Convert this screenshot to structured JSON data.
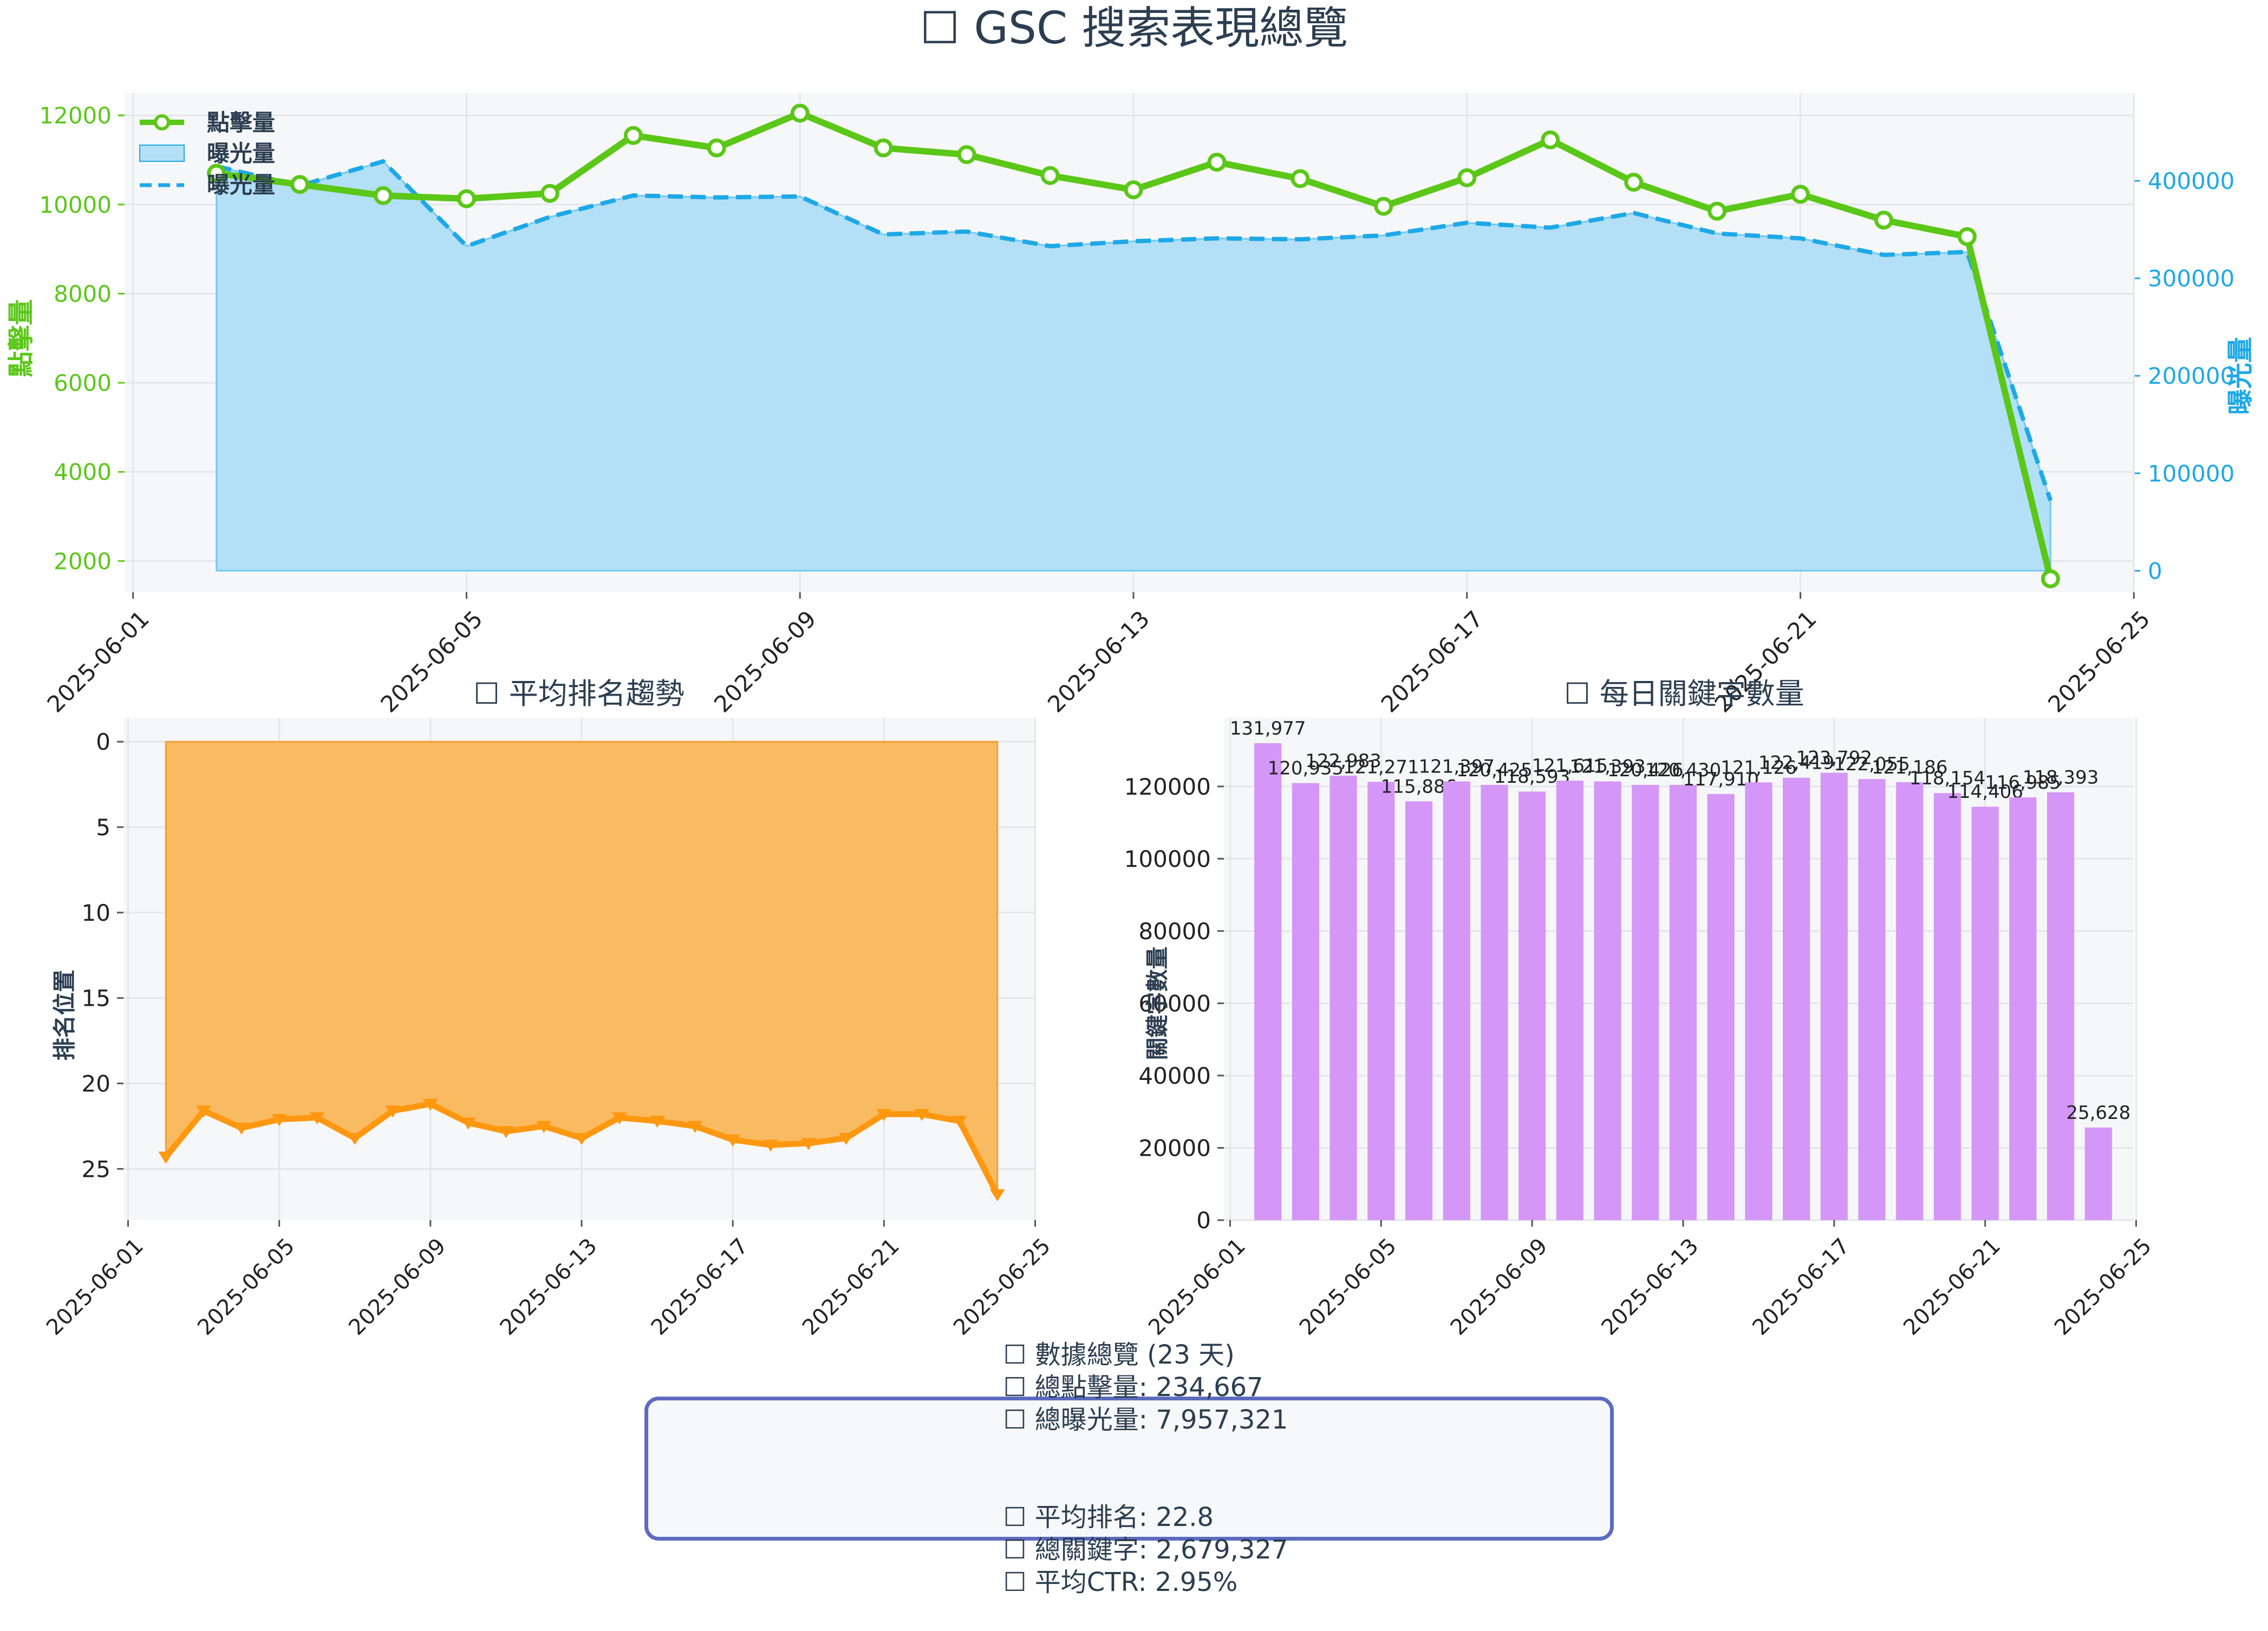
{
  "main_title": "☐ GSC 搜索表現總覽",
  "summary": {
    "line1": [
      "☐ 數據總覽 (23 天)",
      "☐ 總點擊量: 234,667",
      "☐ 總曝光量: 7,957,321"
    ],
    "line2": [
      "☐ 平均排名: 22.8",
      "☐ 總關鍵字: 2,679,327",
      "☐ 平均CTR: 2.95%"
    ]
  },
  "colors": {
    "clicks": "#5bc718",
    "impressions": "#1ea8e6",
    "impressions_fill": "#b3e0f7",
    "position": "#ff9810",
    "position_fill": "#f9bb62",
    "keywords": "#d497f8",
    "plot_bg": "#f6f7f9",
    "grid": "#e4e6ea",
    "summary_border": "#5c6bc0"
  },
  "chart_data": [
    {
      "type": "line",
      "title": "",
      "x_ticks": [
        "2025-06-01",
        "2025-06-05",
        "2025-06-09",
        "2025-06-13",
        "2025-06-17",
        "2025-06-21",
        "2025-06-25"
      ],
      "x": [
        "2025-06-02",
        "2025-06-03",
        "2025-06-04",
        "2025-06-05",
        "2025-06-06",
        "2025-06-07",
        "2025-06-08",
        "2025-06-09",
        "2025-06-10",
        "2025-06-11",
        "2025-06-12",
        "2025-06-13",
        "2025-06-14",
        "2025-06-15",
        "2025-06-16",
        "2025-06-17",
        "2025-06-18",
        "2025-06-19",
        "2025-06-20",
        "2025-06-21",
        "2025-06-22",
        "2025-06-23",
        "2025-06-24"
      ],
      "ylabel": "點擊量",
      "ylabel_right": "曝光量",
      "y_ticks": [
        2000,
        4000,
        6000,
        8000,
        10000,
        12000
      ],
      "ylim": [
        1300,
        12500
      ],
      "y2_ticks": [
        0,
        100000,
        200000,
        300000,
        400000
      ],
      "y2lim": [
        -22000,
        490000
      ],
      "legend": [
        "點擊量",
        "曝光量",
        "曝光量"
      ],
      "legend_position": "upper left",
      "series": [
        {
          "name": "點擊量",
          "axis": "left",
          "style": "line-markers",
          "values": [
            10700,
            10450,
            10200,
            10130,
            10250,
            11550,
            11270,
            12050,
            11270,
            11120,
            10650,
            10330,
            10950,
            10580,
            9960,
            10600,
            11450,
            10500,
            9850,
            10230,
            9650,
            9280,
            1600
          ]
        },
        {
          "name": "曝光量",
          "axis": "right",
          "style": "area",
          "values": [
            415000,
            395000,
            420000,
            333000,
            363000,
            385000,
            383000,
            384000,
            345000,
            348000,
            333000,
            338000,
            341000,
            340000,
            344000,
            357000,
            352000,
            367000,
            346000,
            341000,
            324000,
            327000,
            72000
          ]
        },
        {
          "name": "曝光量",
          "axis": "right",
          "style": "dashed",
          "values": [
            415000,
            395000,
            420000,
            333000,
            363000,
            385000,
            383000,
            384000,
            345000,
            348000,
            333000,
            338000,
            341000,
            340000,
            344000,
            357000,
            352000,
            367000,
            346000,
            341000,
            324000,
            327000,
            72000
          ]
        }
      ]
    },
    {
      "type": "area",
      "title": "☐ 平均排名趨勢",
      "ylabel": "排名位置",
      "inverted_y": true,
      "ylim": [
        28,
        -1.4
      ],
      "y_ticks": [
        0,
        5,
        10,
        15,
        20,
        25
      ],
      "x_ticks": [
        "2025-06-01",
        "2025-06-05",
        "2025-06-09",
        "2025-06-13",
        "2025-06-17",
        "2025-06-21",
        "2025-06-25"
      ],
      "x": [
        "2025-06-02",
        "2025-06-03",
        "2025-06-04",
        "2025-06-05",
        "2025-06-06",
        "2025-06-07",
        "2025-06-08",
        "2025-06-09",
        "2025-06-10",
        "2025-06-11",
        "2025-06-12",
        "2025-06-13",
        "2025-06-14",
        "2025-06-15",
        "2025-06-16",
        "2025-06-17",
        "2025-06-18",
        "2025-06-19",
        "2025-06-20",
        "2025-06-21",
        "2025-06-22",
        "2025-06-23",
        "2025-06-24"
      ],
      "values": [
        24.3,
        21.6,
        22.6,
        22.1,
        22.0,
        23.2,
        21.6,
        21.2,
        22.3,
        22.8,
        22.5,
        23.2,
        22.0,
        22.2,
        22.5,
        23.3,
        23.6,
        23.5,
        23.2,
        21.8,
        21.8,
        22.2,
        26.5
      ]
    },
    {
      "type": "bar",
      "title": "☐ 每日關鍵字數量",
      "ylabel": "關鍵字數量",
      "ylim": [
        0,
        139000
      ],
      "y_ticks": [
        0,
        20000,
        40000,
        60000,
        80000,
        100000,
        120000
      ],
      "x_ticks": [
        "2025-06-01",
        "2025-06-05",
        "2025-06-09",
        "2025-06-13",
        "2025-06-17",
        "2025-06-21",
        "2025-06-25"
      ],
      "x": [
        "2025-06-02",
        "2025-06-03",
        "2025-06-04",
        "2025-06-05",
        "2025-06-06",
        "2025-06-07",
        "2025-06-08",
        "2025-06-09",
        "2025-06-10",
        "2025-06-11",
        "2025-06-12",
        "2025-06-13",
        "2025-06-14",
        "2025-06-15",
        "2025-06-16",
        "2025-06-17",
        "2025-06-18",
        "2025-06-19",
        "2025-06-20",
        "2025-06-21",
        "2025-06-22",
        "2025-06-23",
        "2025-06-24"
      ],
      "values": [
        131977,
        120935,
        122983,
        121271,
        115886,
        121397,
        120425,
        118593,
        121615,
        121393,
        120426,
        120430,
        117910,
        121126,
        122419,
        123792,
        122055,
        121186,
        118154,
        114406,
        116985,
        118393,
        25628
      ],
      "data_labels": [
        "131,977",
        "120,935",
        "122,983",
        "121,271",
        "115,886",
        "121,397",
        "120,425",
        "118,593",
        "121,615",
        "121,393",
        "120,426",
        "120,430",
        "117,910",
        "121,126",
        "122,419",
        "123,792",
        "122,055",
        "121,186",
        "118,154",
        "114,406",
        "116,985",
        "118,393",
        "25,628"
      ]
    }
  ]
}
